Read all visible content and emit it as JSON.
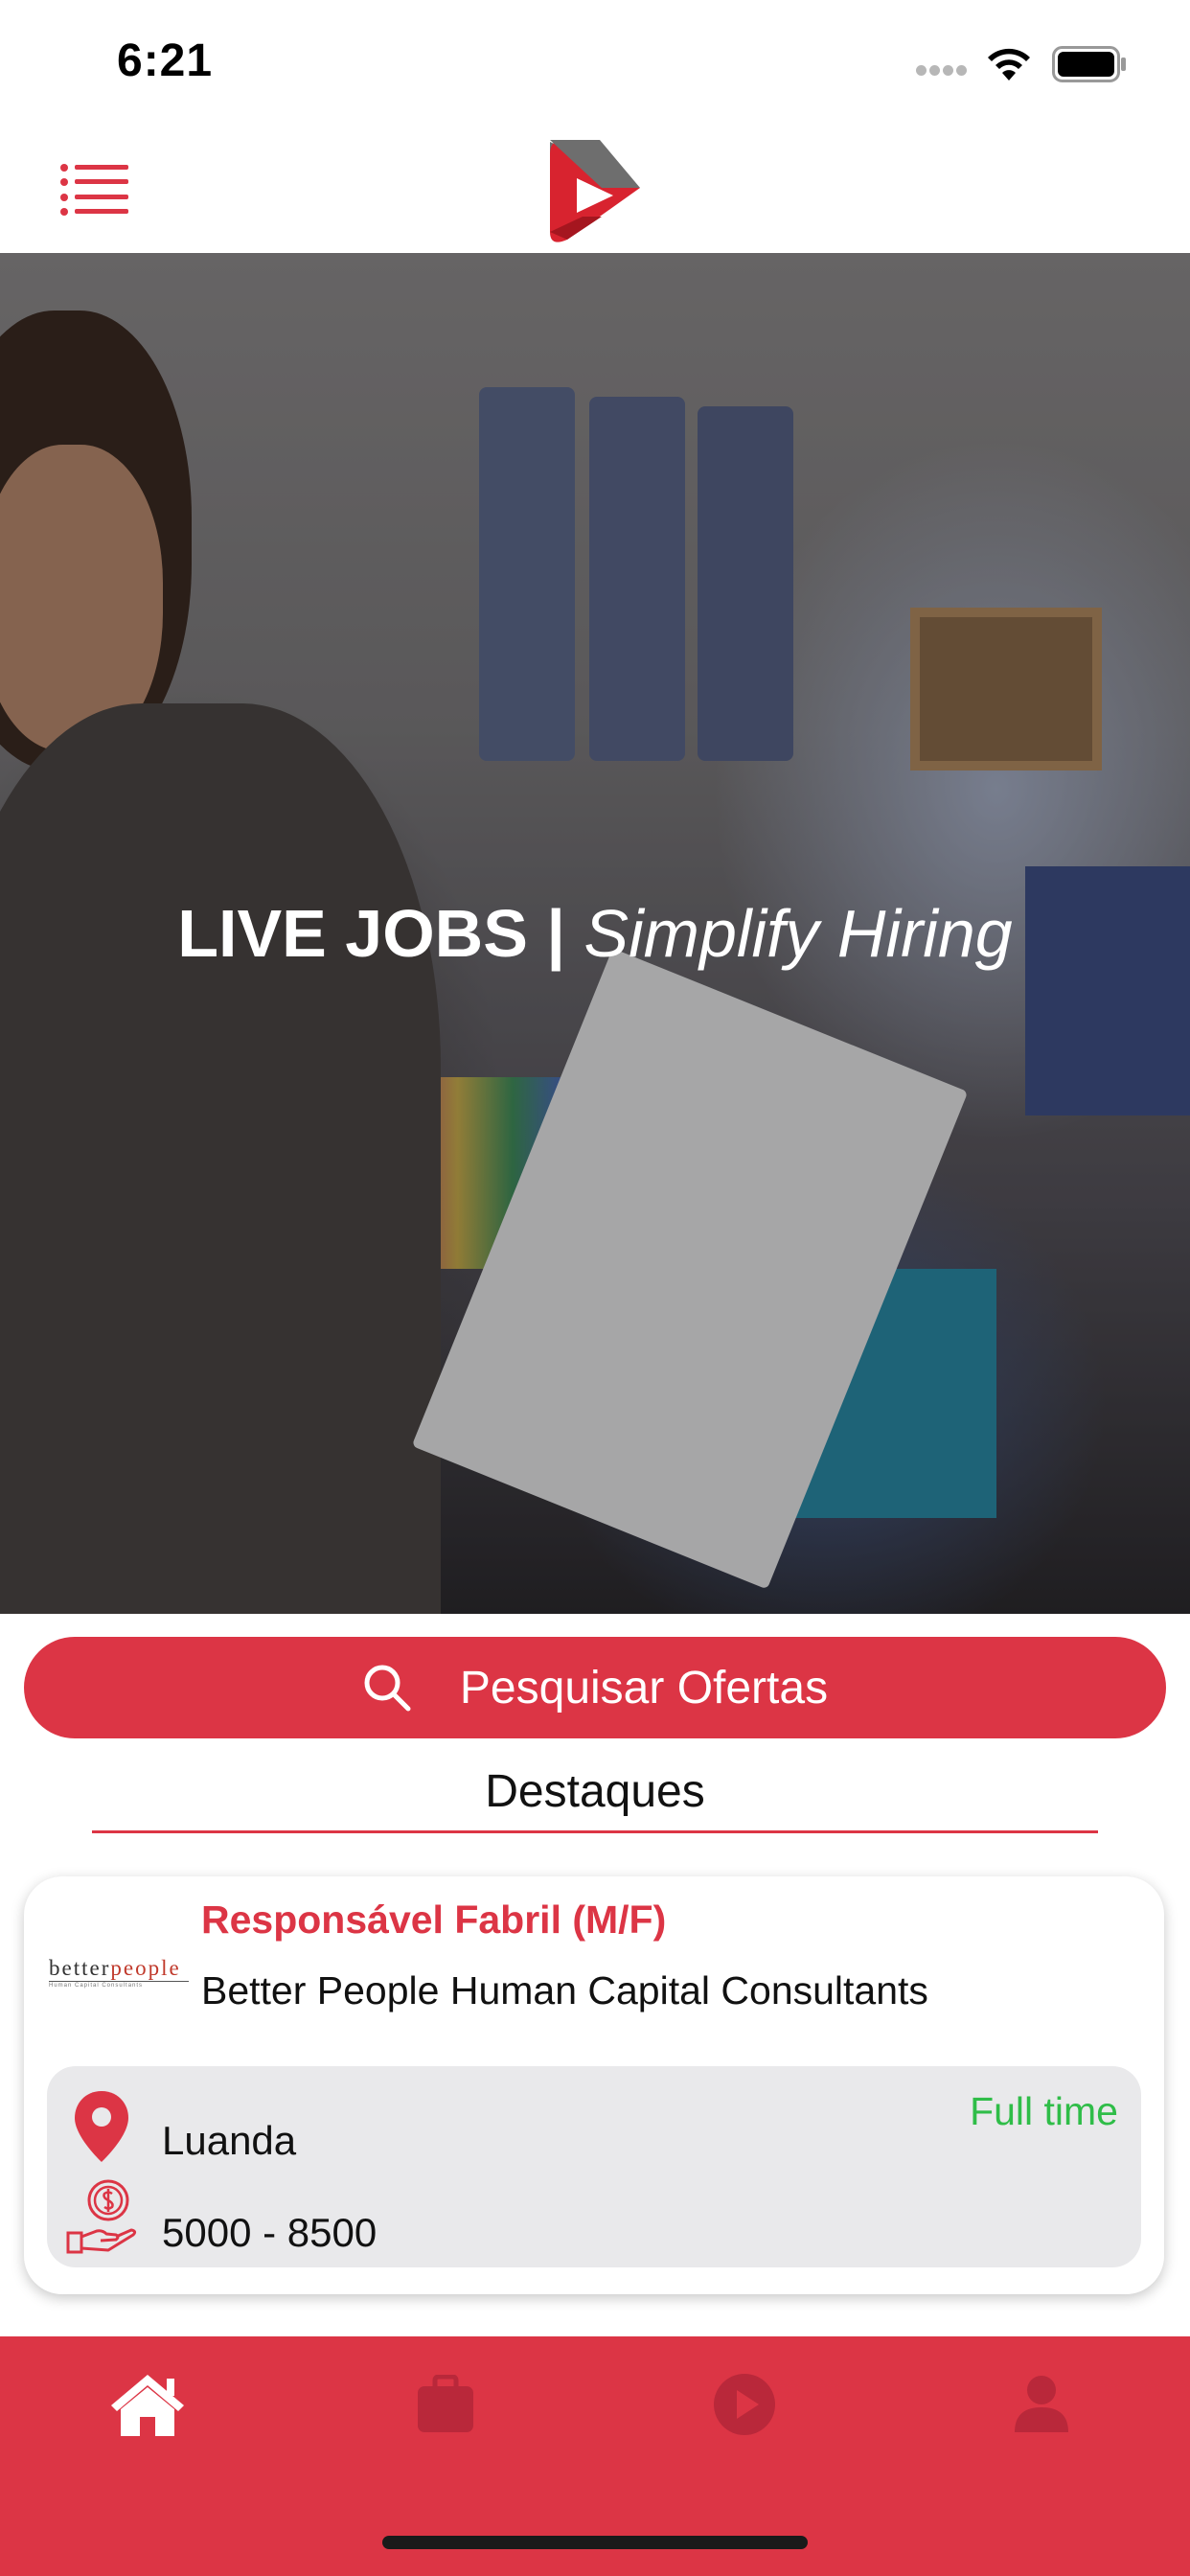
{
  "status_bar": {
    "time": "6:21"
  },
  "hero": {
    "title_strong": "LIVE JOBS |",
    "title_em": "Simplify Hiring"
  },
  "search": {
    "label": "Pesquisar Ofertas"
  },
  "section": {
    "title": "Destaques"
  },
  "job_card": {
    "title": "Responsável Fabril (M/F)",
    "company": "Better People Human Capital Consultants",
    "company_logo_text": {
      "better": "better",
      "people": "people",
      "sub": "Human Capital Consultants"
    },
    "location": "Luanda",
    "job_type": "Full time",
    "salary": "5000 - 8500"
  },
  "tab_bar": {
    "items": [
      "home-icon",
      "briefcase-icon",
      "play-icon",
      "profile-icon"
    ],
    "active": "home-icon"
  },
  "colors": {
    "accent": "#dc3545",
    "job_type": "#2fbd48",
    "info_bg": "#e9e9eb"
  }
}
